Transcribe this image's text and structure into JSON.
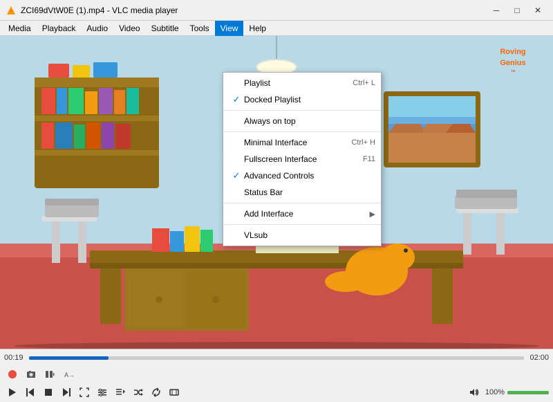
{
  "titleBar": {
    "title": "ZCI69dVtW0E (1).mp4 - VLC media player",
    "minBtn": "─",
    "maxBtn": "□",
    "closeBtn": "✕"
  },
  "menuBar": {
    "items": [
      {
        "id": "media",
        "label": "Media"
      },
      {
        "id": "playback",
        "label": "Playback"
      },
      {
        "id": "audio",
        "label": "Audio"
      },
      {
        "id": "video",
        "label": "Video"
      },
      {
        "id": "subtitle",
        "label": "Subtitle"
      },
      {
        "id": "tools",
        "label": "Tools"
      },
      {
        "id": "view",
        "label": "View",
        "active": true
      },
      {
        "id": "help",
        "label": "Help"
      }
    ]
  },
  "viewMenu": {
    "items": [
      {
        "id": "playlist",
        "label": "Playlist",
        "shortcut": "Ctrl+ L",
        "checked": false,
        "separator_after": false
      },
      {
        "id": "docked-playlist",
        "label": "Docked Playlist",
        "shortcut": "",
        "checked": true,
        "separator_after": true
      },
      {
        "id": "always-on-top",
        "label": "Always on top",
        "shortcut": "",
        "checked": false,
        "separator_after": false
      },
      {
        "id": "minimal-interface",
        "label": "Minimal Interface",
        "shortcut": "Ctrl+ H",
        "checked": false,
        "separator_after": false
      },
      {
        "id": "fullscreen-interface",
        "label": "Fullscreen Interface",
        "shortcut": "F11",
        "checked": false,
        "separator_after": false
      },
      {
        "id": "advanced-controls",
        "label": "Advanced Controls",
        "shortcut": "",
        "checked": true,
        "separator_after": false
      },
      {
        "id": "status-bar",
        "label": "Status Bar",
        "shortcut": "",
        "checked": false,
        "separator_after": true
      },
      {
        "id": "add-interface",
        "label": "Add Interface",
        "shortcut": "",
        "hasArrow": true,
        "checked": false,
        "separator_after": true
      },
      {
        "id": "vlsub",
        "label": "VLsub",
        "shortcut": "",
        "checked": false,
        "separator_after": false
      }
    ]
  },
  "player": {
    "currentTime": "00:19",
    "totalTime": "02:00",
    "progressPercent": 16,
    "volumePercent": 100,
    "volumeLabel": "100%"
  },
  "controls": {
    "record": "⏺",
    "snapshot": "📷",
    "frameByFrame": "⏭",
    "loop": "🔁",
    "play": "▶",
    "prevChapter": "⏮",
    "stop": "⏹",
    "nextChapter": "⏭",
    "toggleFullscreen": "⛶",
    "extendedSettings": "≡",
    "showPlaylist": "☰",
    "random": "🔀",
    "loop2": "↺",
    "aspectRatio": "⊡",
    "volume": "🔊"
  }
}
